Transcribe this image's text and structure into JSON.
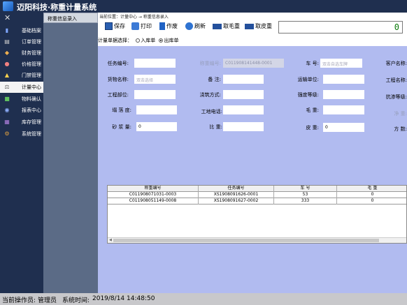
{
  "app": {
    "title": "迈阳科技·称重计量系统"
  },
  "sidebar": {
    "items": [
      {
        "label": "基础档案",
        "icon": "archive-icon",
        "color": "#7fa7ff"
      },
      {
        "label": "订单管理",
        "icon": "order-icon",
        "color": "#d0d0d0"
      },
      {
        "label": "财务管理",
        "icon": "finance-icon",
        "color": "#f0b050"
      },
      {
        "label": "价格管理",
        "icon": "price-icon",
        "color": "#f08080"
      },
      {
        "label": "门禁管理",
        "icon": "gate-icon",
        "color": "#ffd24d"
      },
      {
        "label": "计量中心",
        "icon": "measure-icon",
        "color": "#555555"
      },
      {
        "label": "物料确认",
        "icon": "material-icon",
        "color": "#60c060"
      },
      {
        "label": "报表中心",
        "icon": "report-icon",
        "color": "#8fb0ff"
      },
      {
        "label": "库存管理",
        "icon": "inventory-icon",
        "color": "#b080e0"
      },
      {
        "label": "系统管理",
        "icon": "system-icon",
        "color": "#e0a040"
      }
    ]
  },
  "tabs": [
    {
      "label": "称重信息录入"
    }
  ],
  "breadcrumb": "当前位置：计量中心 → 称重信息录入",
  "toolbar": {
    "save": "保存",
    "print": "打印",
    "void": "作废",
    "refresh": "刷新",
    "gross": "取毛重",
    "tare": "取皮重"
  },
  "weight_display": "0",
  "direction": {
    "label": "计量单据选择：",
    "in": "入库单",
    "out": "出库单",
    "selected": "out"
  },
  "form": {
    "task_no": "任务编号:",
    "weigh_no": "称重编号:",
    "weigh_no_value": "C011908141448-0001",
    "plate_no": "车    号:",
    "plate_placeholder": "双击自选车牌",
    "customer": "客户名称:",
    "goods": "货物名称:",
    "goods_placeholder": "双击选择",
    "remark": "备    注:",
    "carrier": "运输单位:",
    "project": "工程名称:",
    "part": "工程部位:",
    "pour": "浇筑方式:",
    "strength": "强度等级:",
    "impermeability": "抗渗等级:",
    "slump": "塌 落 度:",
    "site_phone": "工地电话:",
    "gross": "毛    重:",
    "net": "净    重:",
    "mortar": "砂 浆 量:",
    "mortar_value": "0",
    "density": "比    重:",
    "tare": "皮    重:",
    "tare_value": "0",
    "volume": "方    数:"
  },
  "table": {
    "columns": [
      "称重编号",
      "任务编号",
      "车    号",
      "毛    重"
    ],
    "rows": [
      [
        "C011908071031-0003",
        "XS1908091626-0001",
        "53",
        "0"
      ],
      [
        "C011908051149-0008",
        "XS1908091627-0002",
        "333",
        "0"
      ]
    ]
  },
  "status": {
    "operator_label": "当前操作员:",
    "operator": "管理员",
    "time_label": "系统时间:",
    "time": "2019/8/14 14:48:50"
  }
}
